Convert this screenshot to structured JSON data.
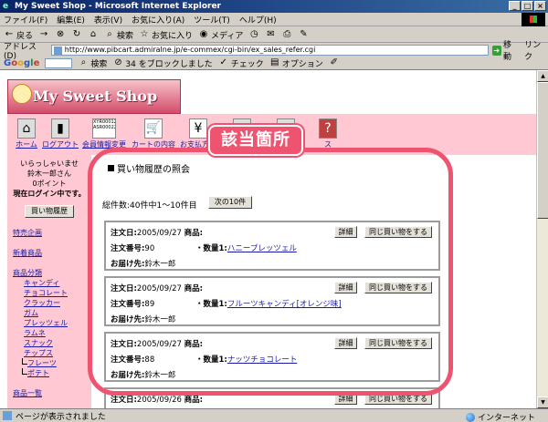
{
  "window": {
    "title": "My Sweet Shop - Microsoft Internet Explorer",
    "controls": [
      "_",
      "□",
      "×"
    ]
  },
  "menubar": [
    "ファイル(F)",
    "編集(E)",
    "表示(V)",
    "お気に入り(A)",
    "ツール(T)",
    "ヘルプ(H)"
  ],
  "toolbar": {
    "back": "戻る",
    "search": "検索",
    "favorites": "お気に入り",
    "media": "メディア"
  },
  "address": {
    "label": "アドレス(D)",
    "url": "http://www.pibcart.admiralne.jp/e-commex/cgi-bin/ex_sales_refer.cgi",
    "go": "移動",
    "links": "リンク"
  },
  "googlebar": {
    "logo": "Google",
    "search_btn": "検索",
    "blocked": "34 をブロックしました",
    "check": "チェック",
    "options": "オプション"
  },
  "site": {
    "logo": "My Sweet Shop",
    "nav": [
      {
        "label": "ホーム",
        "icon": "home-icon",
        "glyph": "⌂"
      },
      {
        "label": "ログアウト",
        "icon": "logout-door-icon",
        "glyph": "▮"
      },
      {
        "label": "会員情報変更",
        "icon": "member-card-icon",
        "glyph": "XYR00012 ASR00022"
      },
      {
        "label": "カートの内容",
        "icon": "cart-icon",
        "glyph": "🛒"
      },
      {
        "label": "お支払方法",
        "icon": "yen-icon",
        "glyph": "¥"
      },
      {
        "label": "",
        "icon": "truck-icon",
        "glyph": ""
      },
      {
        "label": "",
        "icon": "person-icon",
        "glyph": ""
      },
      {
        "label": "ス",
        "icon": "help-icon",
        "glyph": "?"
      }
    ],
    "greeting": [
      "いらっしゃいませ",
      "鈴木一郎さん",
      "0ポイント",
      "現在ログイン中です。"
    ],
    "history_button": "買い物履歴",
    "side_links": [
      {
        "label": "特売企画",
        "level": 0
      },
      {
        "label": "新着商品",
        "level": 0
      },
      {
        "label": "商品分類",
        "level": 0
      },
      {
        "label": "キャンディ",
        "level": 1
      },
      {
        "label": "チョコレート",
        "level": 1
      },
      {
        "label": "クラッカー",
        "level": 1
      },
      {
        "label": "ガム",
        "level": 1
      },
      {
        "label": "プレッツェル",
        "level": 1
      },
      {
        "label": "ラムネ",
        "level": 1
      },
      {
        "label": "スナック",
        "level": 1
      },
      {
        "label": "チップス",
        "level": 1
      },
      {
        "label": "フレーツ",
        "level": 2
      },
      {
        "label": "ポテト",
        "level": 2
      },
      {
        "label": "商品一覧",
        "level": 0
      }
    ],
    "heading": "買い物履歴の照会",
    "total": "総件数:40件中1～10件目",
    "next_button": "次の10件",
    "order_labels": {
      "date": "注文日:",
      "product": "商品:",
      "number": "注文番号:",
      "qty": "・数量1:",
      "ship": "お届け先:",
      "detail": "詳細",
      "again": "同じ買い物をする"
    },
    "orders": [
      {
        "date": "2005/09/27",
        "number": "90",
        "product": "ハニープレッツェル",
        "ship_to": "鈴木一郎"
      },
      {
        "date": "2005/09/27",
        "number": "89",
        "product": "フルーツキャンディ[オレンジ味]",
        "ship_to": "鈴木一郎"
      },
      {
        "date": "2005/09/27",
        "number": "88",
        "product": "ナッツチョコレート",
        "ship_to": "鈴木一郎"
      },
      {
        "date": "2005/09/26",
        "number": "",
        "product": "",
        "ship_to": ""
      }
    ]
  },
  "annotation": {
    "label": "該当箇所",
    "color": "#ee5470"
  },
  "status": {
    "text": "ページが表示されました",
    "zone": "インターネット"
  }
}
